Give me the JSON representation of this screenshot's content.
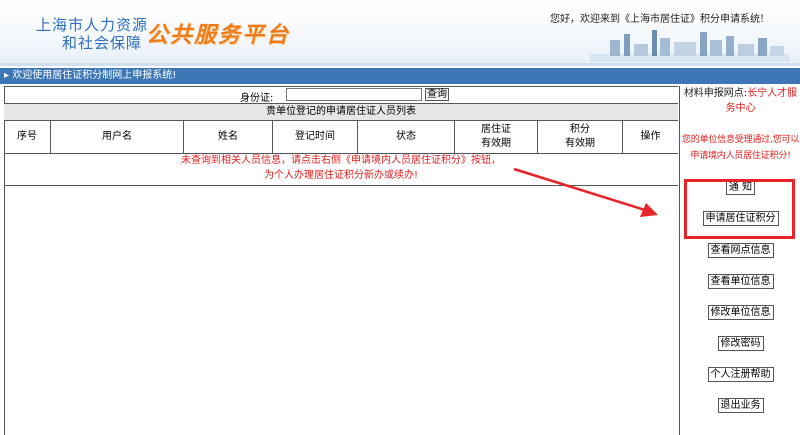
{
  "header": {
    "logo_line1": "上海市人力资源",
    "logo_line2": "和社会保障",
    "logo_title": "公共服务平台",
    "welcome": "您好，欢迎来到《上海市居住证》积分申请系统!"
  },
  "welcome_bar": "▸ 欢迎使用居住证积分制网上申报系统!",
  "search": {
    "label": "身份证:",
    "value": "",
    "button": "查询"
  },
  "list": {
    "title": "贵单位登记的申请居住证人员列表",
    "columns": [
      "序号",
      "用户名",
      "姓名",
      "登记时间",
      "状态",
      "居住证\n有效期",
      "积分\n有效期",
      "操作"
    ],
    "message_line1": "未查询到相关人员信息，请点击右侧《申请境内人员居住证积分》按钮，",
    "message_line2": "为个人办理居住证积分新办或续办!"
  },
  "sidebar": {
    "material_label": "材料申报网点:",
    "material_value": "长宁人才服务中心",
    "notice": "您的单位信息受理通过,您可以申请境内人员居住证积分!",
    "links": [
      "通 知",
      "申请居住证积分",
      "查看网点信息",
      "查看单位信息",
      "修改单位信息",
      "修改密码",
      "个人注册帮助",
      "退出业务"
    ]
  },
  "colors": {
    "bar_blue": "#3c76b4",
    "highlight_red": "#e8232a",
    "message_red": "#e01e1e",
    "logo_orange": "#ef7c1b",
    "logo_blue": "#2f6fc0"
  }
}
